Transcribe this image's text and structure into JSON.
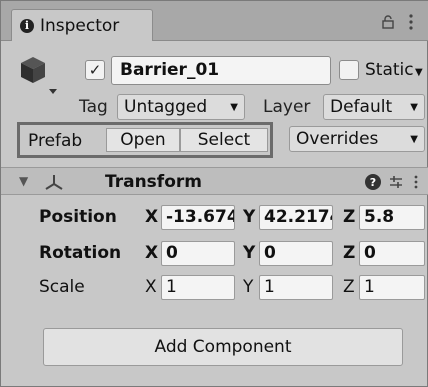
{
  "tab": {
    "title": "Inspector"
  },
  "object": {
    "active": true,
    "name": "Barrier_01",
    "static_label": "Static",
    "static_checked": false
  },
  "tag": {
    "label": "Tag",
    "value": "Untagged"
  },
  "layer": {
    "label": "Layer",
    "value": "Default"
  },
  "prefab": {
    "label": "Prefab",
    "open_label": "Open",
    "select_label": "Select",
    "overrides_label": "Overrides"
  },
  "transform": {
    "title": "Transform",
    "rows": [
      {
        "label": "Position",
        "x": "-13.674",
        "y": "42.2174",
        "z": "5.8"
      },
      {
        "label": "Rotation",
        "x": "0",
        "y": "0",
        "z": "0"
      },
      {
        "label": "Scale",
        "x": "1",
        "y": "1",
        "z": "1"
      }
    ],
    "axes": {
      "x": "X",
      "y": "Y",
      "z": "Z"
    }
  },
  "add_component_label": "Add Component",
  "colors": {
    "panel": "#c8c8c8",
    "tabbar": "#a8a8a8",
    "highlight_border": "#6b6b6b"
  }
}
